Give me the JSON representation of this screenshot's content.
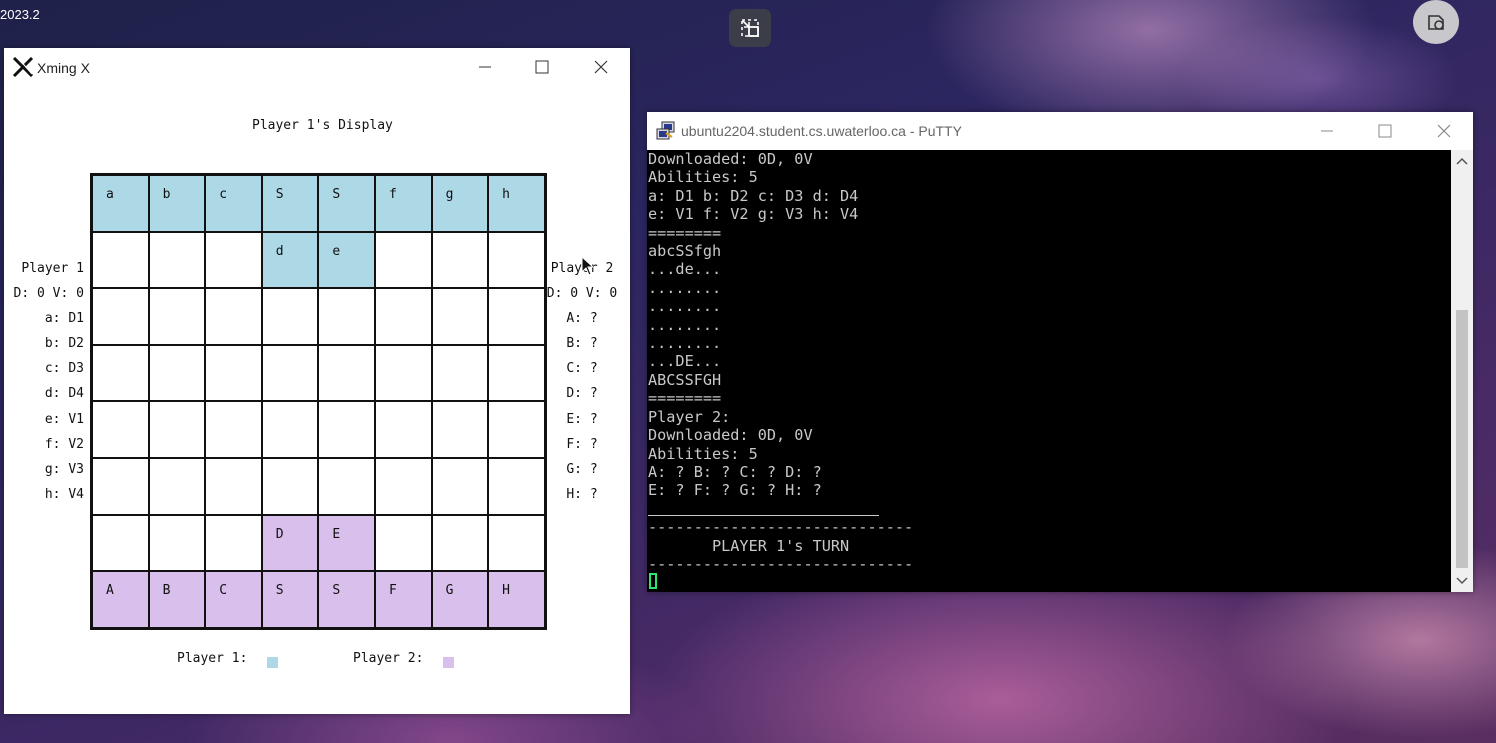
{
  "desktop": {
    "version_text": "2023.2"
  },
  "xming": {
    "title": "Xming X",
    "display_title": "Player 1's Display",
    "board": [
      [
        "a",
        "b",
        "c",
        "S",
        "S",
        "f",
        "g",
        "h"
      ],
      [
        "",
        "",
        "",
        "d",
        "e",
        "",
        "",
        ""
      ],
      [
        "",
        "",
        "",
        "",
        "",
        "",
        "",
        ""
      ],
      [
        "",
        "",
        "",
        "",
        "",
        "",
        "",
        ""
      ],
      [
        "",
        "",
        "",
        "",
        "",
        "",
        "",
        ""
      ],
      [
        "",
        "",
        "",
        "",
        "",
        "",
        "",
        ""
      ],
      [
        "",
        "",
        "",
        "D",
        "E",
        "",
        "",
        ""
      ],
      [
        "A",
        "B",
        "C",
        "S",
        "S",
        "F",
        "G",
        "H"
      ]
    ],
    "board_owner": [
      [
        1,
        1,
        1,
        1,
        1,
        1,
        1,
        1
      ],
      [
        0,
        0,
        0,
        1,
        1,
        0,
        0,
        0
      ],
      [
        0,
        0,
        0,
        0,
        0,
        0,
        0,
        0
      ],
      [
        0,
        0,
        0,
        0,
        0,
        0,
        0,
        0
      ],
      [
        0,
        0,
        0,
        0,
        0,
        0,
        0,
        0
      ],
      [
        0,
        0,
        0,
        0,
        0,
        0,
        0,
        0
      ],
      [
        0,
        0,
        0,
        2,
        2,
        0,
        0,
        0
      ],
      [
        2,
        2,
        2,
        2,
        2,
        2,
        2,
        2
      ]
    ],
    "player1_panel": [
      "Player 1",
      "D: 0 V: 0",
      "a: D1",
      "b: D2",
      "c: D3",
      "d: D4",
      "e: V1",
      "f: V2",
      "g: V3",
      "h: V4"
    ],
    "player2_panel": [
      "Player 2",
      "D: 0 V: 0",
      "A: ?",
      "B: ?",
      "C: ?",
      "D: ?",
      "E: ?",
      "F: ?",
      "G: ?",
      "H: ?"
    ],
    "legend": {
      "p1_label": "Player 1:",
      "p2_label": "Player 2:"
    },
    "colors": {
      "player1": "#add8e6",
      "player2": "#d8bfec"
    }
  },
  "putty": {
    "title": "ubuntu2204.student.cs.uwaterloo.ca - PuTTY",
    "lines": [
      "Downloaded: 0D, 0V",
      "Abilities: 5",
      "a: D1 b: D2 c: D3 d: D4",
      "e: V1 f: V2 g: V3 h: V4",
      "========",
      "abcSSfgh",
      "...de...",
      "........",
      "........",
      "........",
      "........",
      "...DE...",
      "ABCSSFGH",
      "========",
      "Player 2:",
      "Downloaded: 0D, 0V",
      "Abilities: 5",
      "A: ? B: ? C: ? D: ?",
      "E: ? F: ? G: ? H: ?",
      "",
      "-----------------------------",
      "       PLAYER 1's TURN",
      "-----------------------------"
    ]
  }
}
